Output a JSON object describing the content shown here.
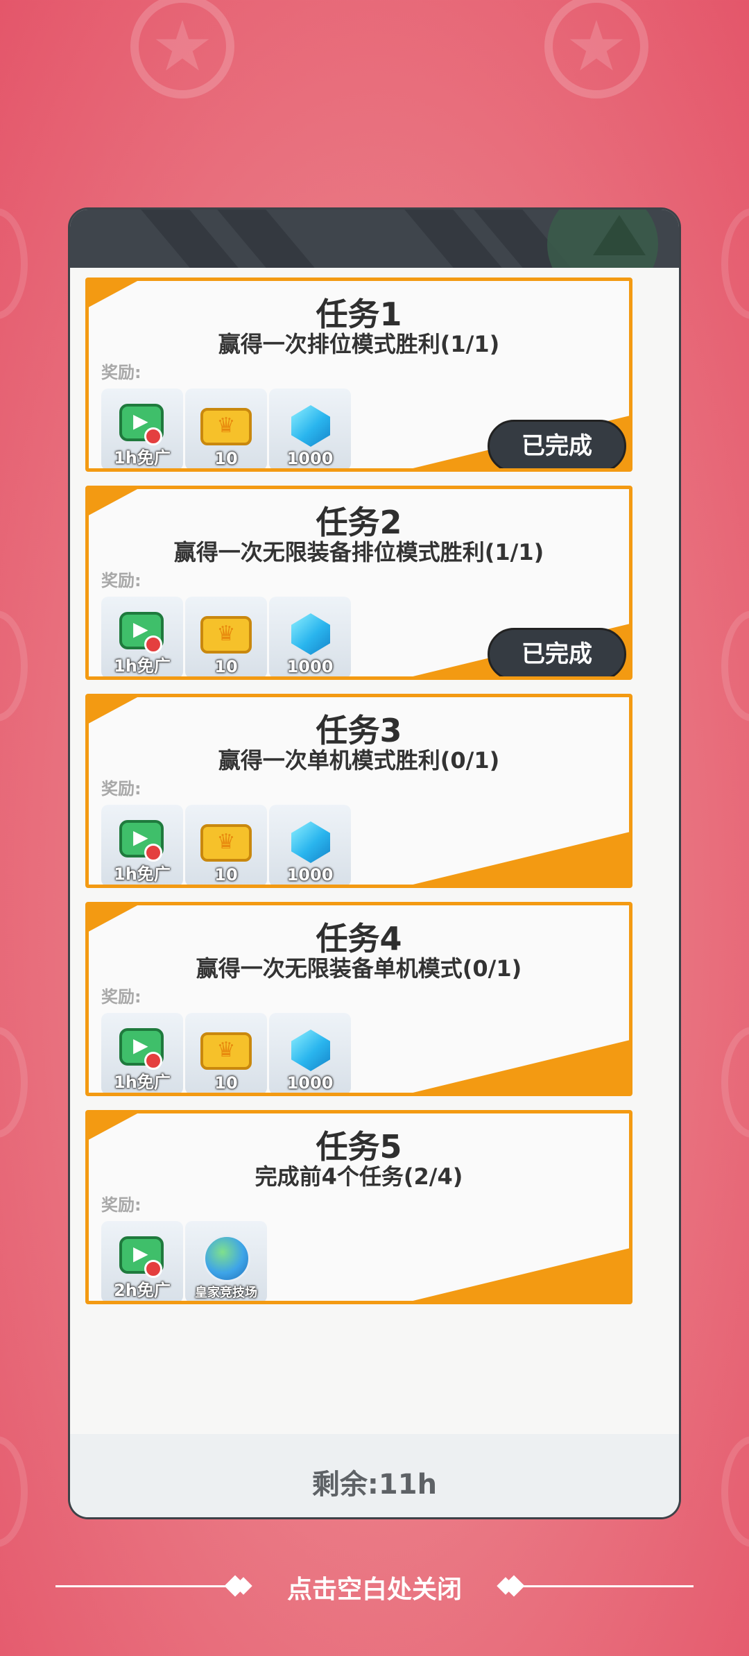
{
  "tasks": [
    {
      "title": "任务1",
      "desc": "赢得一次排位模式胜利(1/1)",
      "reward_label": "奖励:",
      "completed": true,
      "status": "已完成",
      "rewards": [
        {
          "icon": "ad-free-tv-icon",
          "count": "1h免广"
        },
        {
          "icon": "ticket-icon",
          "count": "10"
        },
        {
          "icon": "gem-icon",
          "count": "1000"
        }
      ]
    },
    {
      "title": "任务2",
      "desc": "赢得一次无限装备排位模式胜利(1/1)",
      "reward_label": "奖励:",
      "completed": true,
      "status": "已完成",
      "rewards": [
        {
          "icon": "ad-free-tv-icon",
          "count": "1h免广"
        },
        {
          "icon": "ticket-icon",
          "count": "10"
        },
        {
          "icon": "gem-icon",
          "count": "1000"
        }
      ]
    },
    {
      "title": "任务3",
      "desc": "赢得一次单机模式胜利(0/1)",
      "reward_label": "奖励:",
      "completed": false,
      "rewards": [
        {
          "icon": "ad-free-tv-icon",
          "count": "1h免广"
        },
        {
          "icon": "ticket-icon",
          "count": "10"
        },
        {
          "icon": "gem-icon",
          "count": "1000"
        }
      ]
    },
    {
      "title": "任务4",
      "desc": "赢得一次无限装备单机模式(0/1)",
      "reward_label": "奖励:",
      "completed": false,
      "rewards": [
        {
          "icon": "ad-free-tv-icon",
          "count": "1h免广"
        },
        {
          "icon": "ticket-icon",
          "count": "10"
        },
        {
          "icon": "gem-icon",
          "count": "1000"
        }
      ]
    },
    {
      "title": "任务5",
      "desc": "完成前4个任务(2/4)",
      "reward_label": "奖励:",
      "completed": false,
      "rewards": [
        {
          "icon": "ad-free-tv-icon",
          "count": "2h免广"
        },
        {
          "icon": "royal-arena-globe-icon",
          "count": "皇家竞技场"
        }
      ]
    }
  ],
  "footer": {
    "remaining": "剩余:11h"
  },
  "close_hint": "点击空白处关闭",
  "colors": {
    "accent": "#f39a12",
    "header": "#3f454c",
    "background": "#e4566a"
  }
}
